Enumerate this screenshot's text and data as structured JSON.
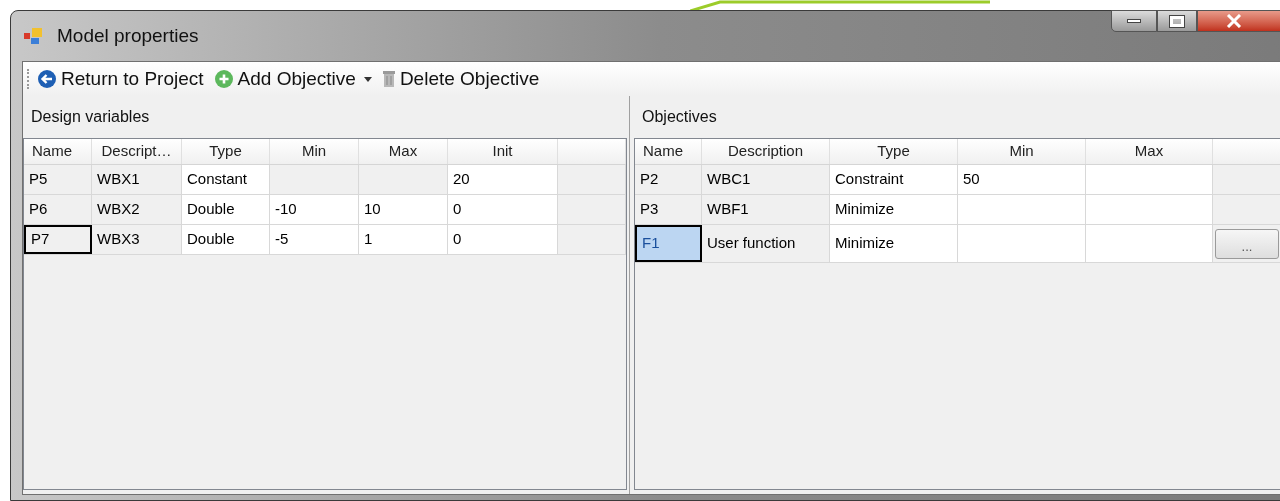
{
  "window": {
    "title": "Model properties"
  },
  "toolbar": [
    {
      "label": "Return to Project",
      "kind": "back",
      "dropdown": false
    },
    {
      "label": "Add Objective",
      "kind": "add",
      "dropdown": true
    },
    {
      "label": "Delete Objective",
      "kind": "delete",
      "dropdown": false
    }
  ],
  "panels": [
    {
      "title": "Design variables",
      "highlight_selection": false,
      "columns": [
        "Name",
        "Descript…",
        "Type",
        "Min",
        "Max",
        "Init"
      ],
      "rows": [
        {
          "selected": false,
          "cells": [
            {
              "text": "P5",
              "disabled": true
            },
            {
              "text": "WBX1",
              "disabled": true
            },
            {
              "text": "Constant",
              "disabled": false
            },
            {
              "disabled": true
            },
            {
              "disabled": true
            },
            {
              "text": "20",
              "disabled": false
            },
            {
              "disabled": true
            }
          ]
        },
        {
          "selected": false,
          "cells": [
            {
              "text": "P6",
              "disabled": true
            },
            {
              "text": "WBX2",
              "disabled": true
            },
            {
              "text": "Double",
              "disabled": false
            },
            {
              "text": "-10",
              "disabled": false
            },
            {
              "text": "10",
              "disabled": false
            },
            {
              "text": "0",
              "disabled": false
            },
            {
              "disabled": true
            }
          ]
        },
        {
          "selected": true,
          "cells": [
            {
              "text": "P7",
              "disabled": true
            },
            {
              "text": "WBX3",
              "disabled": true
            },
            {
              "text": "Double",
              "disabled": false
            },
            {
              "text": "-5",
              "disabled": false
            },
            {
              "text": "1",
              "disabled": false
            },
            {
              "text": "0",
              "disabled": false
            },
            {
              "disabled": true
            }
          ]
        }
      ]
    },
    {
      "title": "Objectives",
      "highlight_selection": true,
      "columns": [
        "Name",
        "Description",
        "Type",
        "Min",
        "Max"
      ],
      "rows": [
        {
          "selected": false,
          "cells": [
            {
              "text": "P2",
              "disabled": true
            },
            {
              "text": "WBC1",
              "disabled": true
            },
            {
              "text": "Constraint",
              "disabled": false
            },
            {
              "text": "50",
              "disabled": false
            },
            {
              "disabled": false
            },
            {
              "disabled": true
            }
          ]
        },
        {
          "selected": false,
          "cells": [
            {
              "text": "P3",
              "disabled": true
            },
            {
              "text": "WBF1",
              "disabled": true
            },
            {
              "text": "Minimize",
              "disabled": false
            },
            {
              "disabled": false
            },
            {
              "disabled": false
            },
            {
              "disabled": true
            }
          ]
        },
        {
          "selected": true,
          "cells": [
            {
              "text": "F1"
            },
            {
              "text": "User function",
              "disabled": true
            },
            {
              "text": "Minimize",
              "disabled": false
            },
            {
              "disabled": false
            },
            {
              "disabled": false
            },
            {
              "kind": "button",
              "text": "...",
              "disabled": true
            }
          ]
        }
      ]
    }
  ]
}
